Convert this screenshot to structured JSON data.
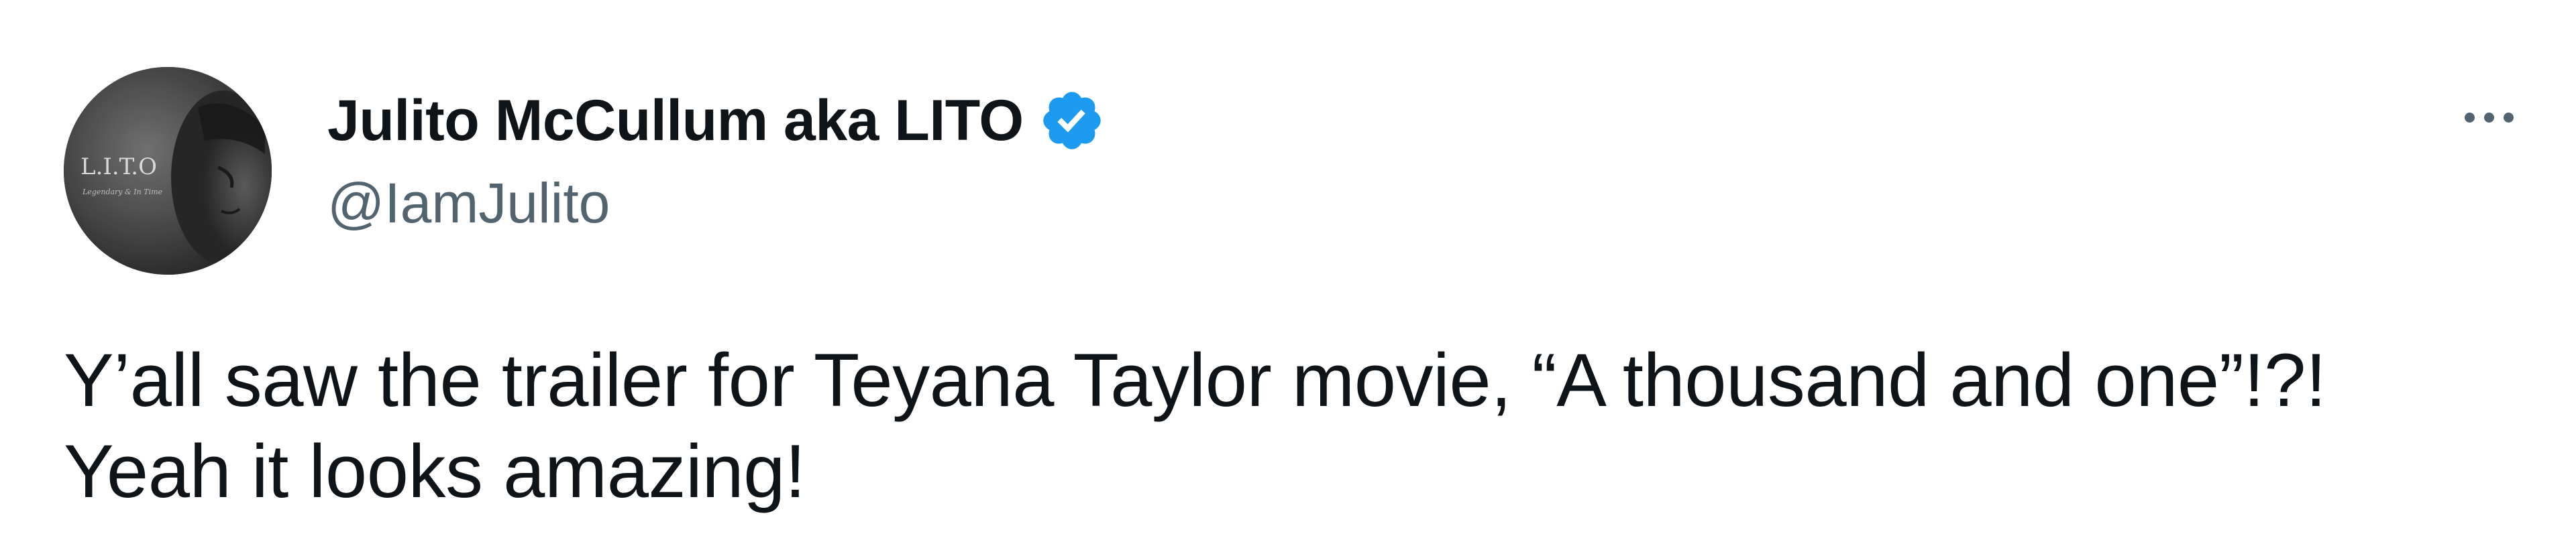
{
  "author": {
    "display_name": "Julito McCullum aka LITO",
    "handle": "@IamJulito",
    "verified": true,
    "avatar_text": "L.I.T.O",
    "avatar_subtext": "Legendary & In Time"
  },
  "tweet": {
    "lines": [
      "Y’all saw the trailer for Teyana Taylor movie, “A thousand and one”!?!",
      "Yeah it looks amazing!"
    ]
  },
  "icons": {
    "verified": "verified-badge-icon",
    "more": "more-options-icon"
  },
  "colors": {
    "verified_blue": "#1d9bf0",
    "secondary_text": "#536471",
    "primary_text": "#0f1419"
  }
}
